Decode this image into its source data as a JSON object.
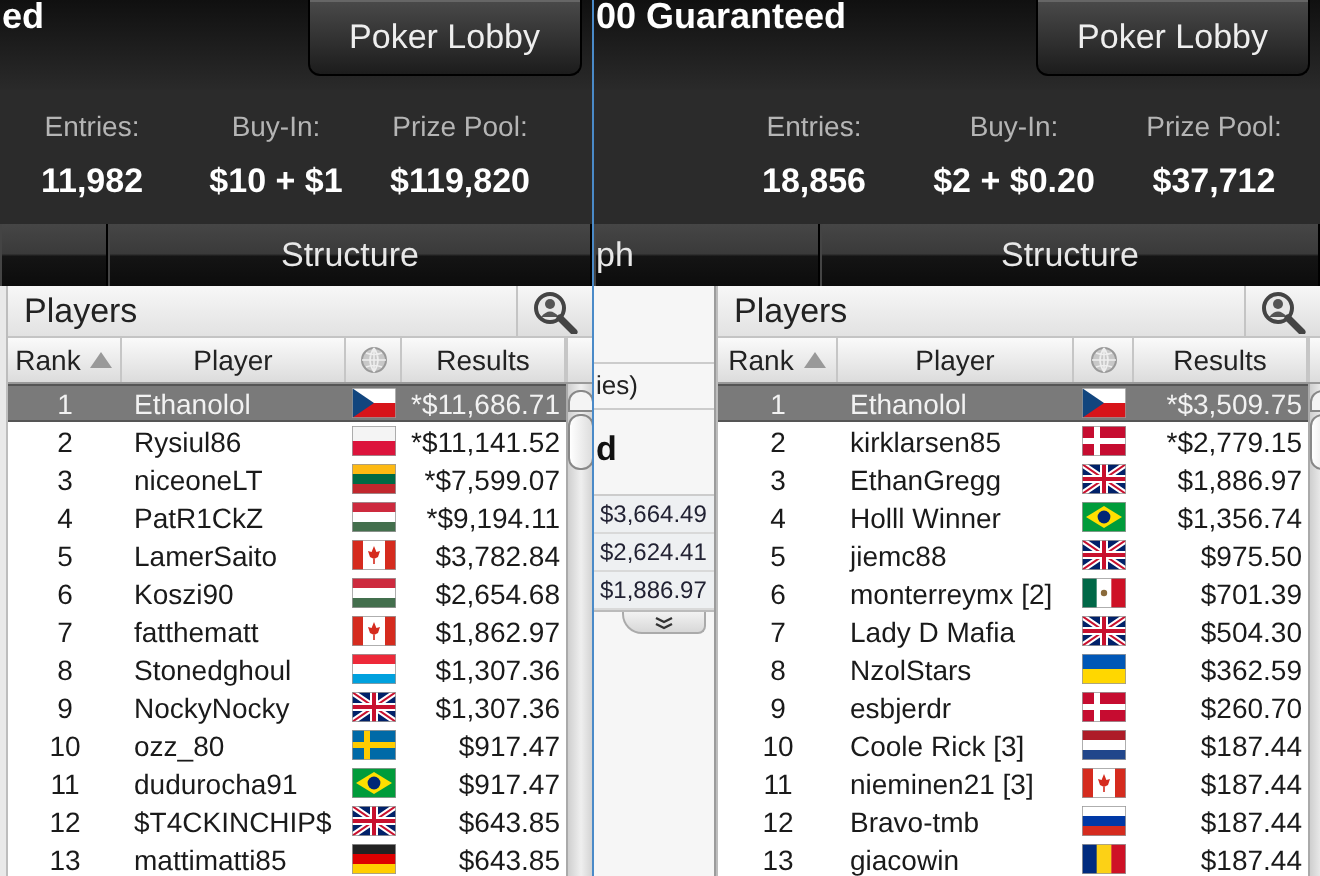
{
  "windows": [
    {
      "title": "ed",
      "lobby_button": "Poker Lobby",
      "stats": [
        {
          "label": "Entries:",
          "value": "11,982"
        },
        {
          "label": "Buy-In:",
          "value": "$10 + $1"
        },
        {
          "label": "Prize Pool:",
          "value": "$119,820"
        }
      ],
      "tabs": [
        {
          "kind": "blank"
        },
        {
          "kind": "text",
          "label": "Structure"
        }
      ],
      "panel": {
        "title": "Players",
        "columns": [
          {
            "kind": "text",
            "label": "Rank",
            "sorted": true
          },
          {
            "kind": "text",
            "label": "Player",
            "sorted": false
          },
          {
            "kind": "globe",
            "sorted": false
          },
          {
            "kind": "text",
            "label": "Results",
            "sorted": false
          }
        ],
        "rows": [
          {
            "rank": "1",
            "player": "Ethanolol",
            "kind": "cz",
            "result": "*$11,686.71",
            "selected": true
          },
          {
            "rank": "2",
            "player": "Rysiul86",
            "kind": "pl",
            "result": "*$11,141.52",
            "selected": false
          },
          {
            "rank": "3",
            "player": "niceoneLT",
            "kind": "lt",
            "result": "*$7,599.07",
            "selected": false
          },
          {
            "rank": "4",
            "player": "PatR1CkZ",
            "kind": "hu",
            "result": "*$9,194.11",
            "selected": false
          },
          {
            "rank": "5",
            "player": "LamerSaito",
            "kind": "ca",
            "result": "$3,782.84",
            "selected": false
          },
          {
            "rank": "6",
            "player": "Koszi90",
            "kind": "hu",
            "result": "$2,654.68",
            "selected": false
          },
          {
            "rank": "7",
            "player": "fatthematt",
            "kind": "ca",
            "result": "$1,862.97",
            "selected": false
          },
          {
            "rank": "8",
            "player": "Stonedghoul",
            "kind": "lu",
            "result": "$1,307.36",
            "selected": false
          },
          {
            "rank": "9",
            "player": "NockyNocky",
            "kind": "gb",
            "result": "$1,307.36",
            "selected": false
          },
          {
            "rank": "10",
            "player": "ozz_80",
            "kind": "se",
            "result": "$917.47",
            "selected": false
          },
          {
            "rank": "11",
            "player": "dudurocha91",
            "kind": "br",
            "result": "$917.47",
            "selected": false
          },
          {
            "rank": "12",
            "player": "$T4CKINCHIP$",
            "kind": "gb",
            "result": "$643.85",
            "selected": false
          },
          {
            "rank": "13",
            "player": "mattimatti85",
            "kind": "de",
            "result": "$643.85",
            "selected": false
          }
        ]
      }
    },
    {
      "title": "00 Guaranteed",
      "lobby_button": "Poker Lobby",
      "stats": [
        {
          "label": "Entries:",
          "value": "18,856"
        },
        {
          "label": "Buy-In:",
          "value": "$2 + $0.20"
        },
        {
          "label": "Prize Pool:",
          "value": "$37,712"
        }
      ],
      "tabs": [
        {
          "kind": "text",
          "label": "ph"
        },
        {
          "kind": "text",
          "label": "Structure"
        }
      ],
      "side_panel": {
        "caption": "ies)",
        "heading": "d",
        "amounts": [
          "$3,664.49",
          "$2,624.41",
          "$1,886.97"
        ]
      },
      "panel": {
        "title": "Players",
        "columns": [
          {
            "kind": "text",
            "label": "Rank",
            "sorted": true
          },
          {
            "kind": "text",
            "label": "Player",
            "sorted": false
          },
          {
            "kind": "globe",
            "sorted": false
          },
          {
            "kind": "text",
            "label": "Results",
            "sorted": false
          }
        ],
        "rows": [
          {
            "rank": "1",
            "player": "Ethanolol",
            "kind": "cz",
            "result": "*$3,509.75",
            "selected": true
          },
          {
            "rank": "2",
            "player": "kirklarsen85",
            "kind": "dk",
            "result": "*$2,779.15",
            "selected": false
          },
          {
            "rank": "3",
            "player": "EthanGregg",
            "kind": "gb",
            "result": "$1,886.97",
            "selected": false
          },
          {
            "rank": "4",
            "player": "Holll Winner",
            "kind": "br",
            "result": "$1,356.74",
            "selected": false
          },
          {
            "rank": "5",
            "player": "jiemc88",
            "kind": "gb",
            "result": "$975.50",
            "selected": false
          },
          {
            "rank": "6",
            "player": "monterreymx [2]",
            "kind": "mx",
            "result": "$701.39",
            "selected": false
          },
          {
            "rank": "7",
            "player": "Lady D Mafia",
            "kind": "gb",
            "result": "$504.30",
            "selected": false
          },
          {
            "rank": "8",
            "player": "NzolStars",
            "kind": "ua",
            "result": "$362.59",
            "selected": false
          },
          {
            "rank": "9",
            "player": "esbjerdr",
            "kind": "dk",
            "result": "$260.70",
            "selected": false
          },
          {
            "rank": "10",
            "player": "Coole Rick [3]",
            "kind": "nl",
            "result": "$187.44",
            "selected": false
          },
          {
            "rank": "11",
            "player": "nieminen21 [3]",
            "kind": "ca",
            "result": "$187.44",
            "selected": false
          },
          {
            "rank": "12",
            "player": "Bravo-tmb",
            "kind": "ru",
            "result": "$187.44",
            "selected": false
          },
          {
            "rank": "13",
            "player": "giacowin",
            "kind": "ro",
            "result": "$187.44",
            "selected": false
          }
        ]
      }
    }
  ]
}
